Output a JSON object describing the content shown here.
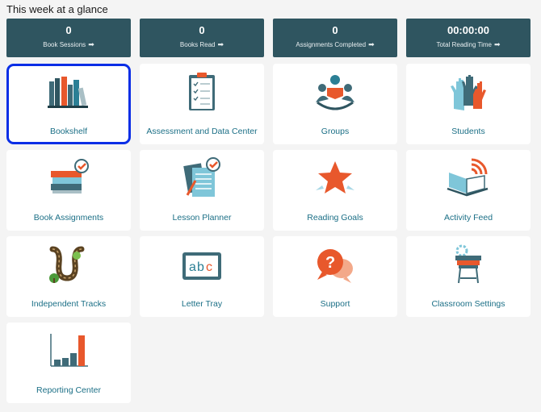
{
  "header": {
    "title": "This week at a glance"
  },
  "stats": [
    {
      "value": "0",
      "label": "Book Sessions"
    },
    {
      "value": "0",
      "label": "Books Read"
    },
    {
      "value": "0",
      "label": "Assignments Completed"
    },
    {
      "value": "00:00:00",
      "label": "Total Reading Time"
    }
  ],
  "colors": {
    "stat_bg": "#2f5560",
    "tile_label": "#1b6f86",
    "selection_border": "#0a2ee6",
    "accent_orange": "#e8582c",
    "accent_teal": "#2b7f95"
  },
  "tiles": [
    {
      "label": "Bookshelf",
      "icon": "bookshelf-icon",
      "selected": true
    },
    {
      "label": "Assessment and Data Center",
      "icon": "clipboard-checklist-icon"
    },
    {
      "label": "Groups",
      "icon": "group-reading-icon"
    },
    {
      "label": "Students",
      "icon": "raised-hands-icon"
    },
    {
      "label": "Book Assignments",
      "icon": "book-stack-check-icon"
    },
    {
      "label": "Lesson Planner",
      "icon": "lesson-planner-icon"
    },
    {
      "label": "Reading Goals",
      "icon": "star-icon"
    },
    {
      "label": "Activity Feed",
      "icon": "open-book-feed-icon"
    },
    {
      "label": "Independent Tracks",
      "icon": "winding-path-icon"
    },
    {
      "label": "Letter Tray",
      "icon": "abc-board-icon"
    },
    {
      "label": "Support",
      "icon": "question-bubble-icon"
    },
    {
      "label": "Classroom Settings",
      "icon": "desk-gear-icon"
    },
    {
      "label": "Reporting Center",
      "icon": "bar-chart-icon"
    }
  ]
}
